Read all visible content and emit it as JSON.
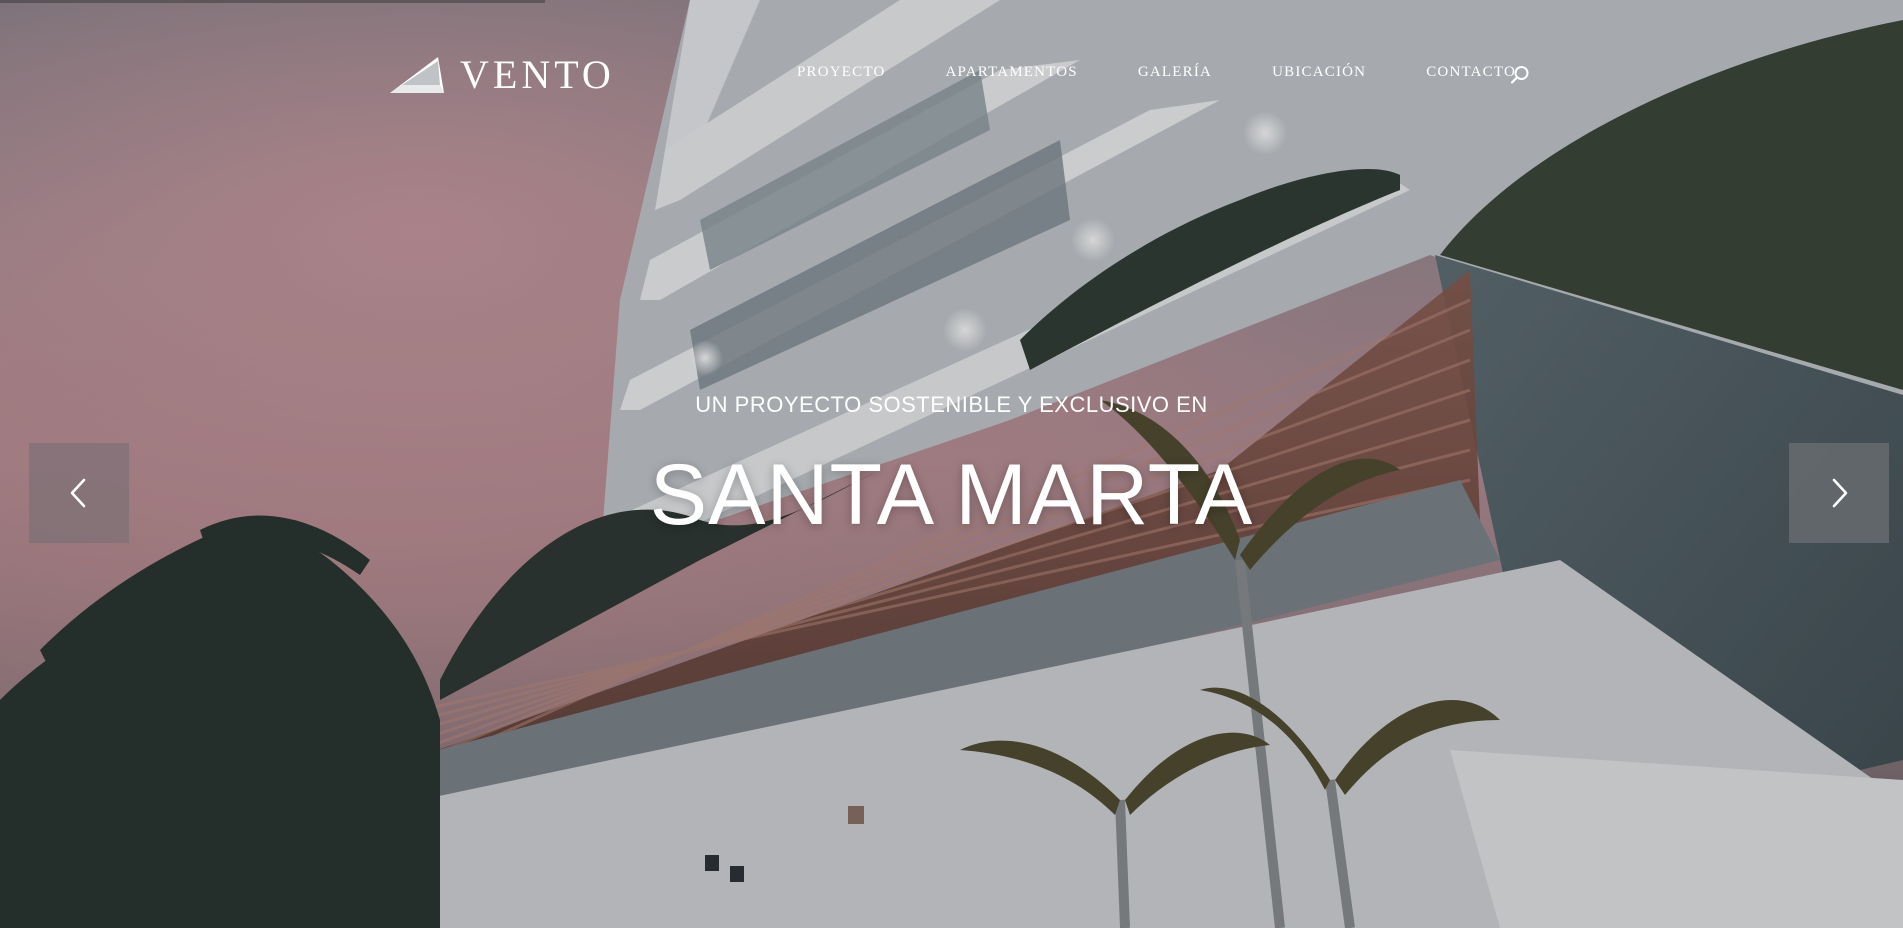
{
  "brand": {
    "name": "VENTO",
    "logo_icon": "mountain-triangle-icon"
  },
  "nav": {
    "items": [
      {
        "label": "PROYECTO"
      },
      {
        "label": "APARTAMENTOS"
      },
      {
        "label": "GALERÍA"
      },
      {
        "label": "UBICACIÓN"
      },
      {
        "label": "CONTACTO"
      }
    ],
    "search_icon": "search-icon"
  },
  "hero": {
    "subtitle": "UN PROYECTO SOSTENIBLE Y EXCLUSIVO EN",
    "title": "SANTA MARTA"
  },
  "slider": {
    "prev_icon": "chevron-left-icon",
    "next_icon": "chevron-right-icon"
  },
  "colors": {
    "text": "#ffffff",
    "arrow_bg": "#7d7076"
  }
}
